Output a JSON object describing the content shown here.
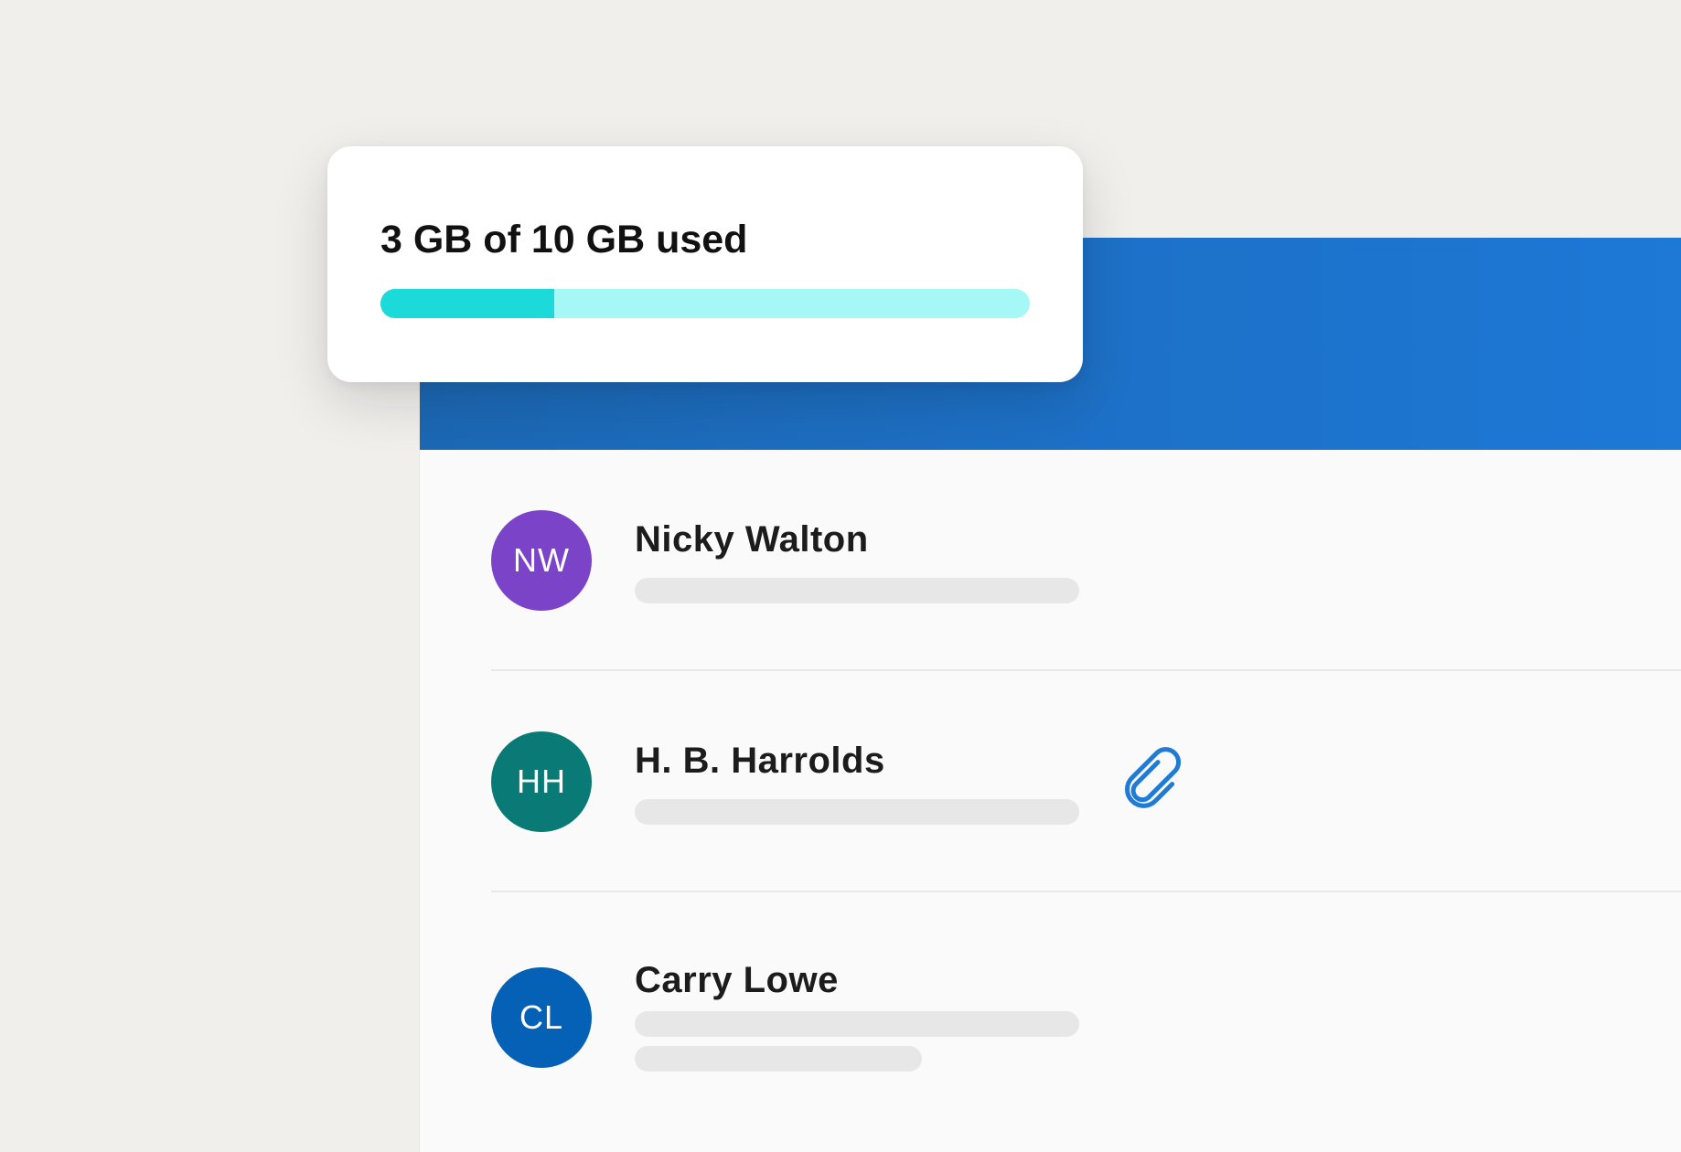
{
  "storage": {
    "label": "3 GB of 10 GB used",
    "used_fraction": 0.3,
    "colors": {
      "track": "#a6f8f6",
      "fill": "#1cd9da"
    }
  },
  "header": {
    "color": "#1d6fc4"
  },
  "contacts": [
    {
      "initials": "NW",
      "name": "Nicky Walton",
      "avatar_color": "#7b44c8",
      "has_attachment": false
    },
    {
      "initials": "HH",
      "name": "H. B. Harrolds",
      "avatar_color": "#0a7a77",
      "has_attachment": true,
      "attachment_icon": "paperclip-icon"
    },
    {
      "initials": "CL",
      "name": "Carry Lowe",
      "avatar_color": "#0561b5",
      "has_attachment": false
    }
  ]
}
